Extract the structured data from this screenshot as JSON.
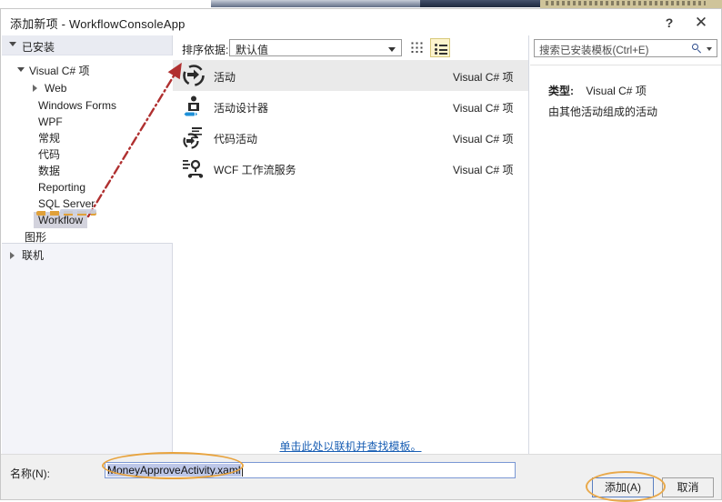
{
  "window": {
    "title": "添加新项 - WorkflowConsoleApp",
    "help_label": "?",
    "close_label": "✕"
  },
  "tree": {
    "header": "已安装",
    "root": "Visual C# 项",
    "items": [
      {
        "label": "Web",
        "expandable": true,
        "indent": 2
      },
      {
        "label": "Windows Forms",
        "expandable": false,
        "indent": 2
      },
      {
        "label": "WPF",
        "expandable": false,
        "indent": 2
      },
      {
        "label": "常规",
        "expandable": false,
        "indent": 2
      },
      {
        "label": "代码",
        "expandable": false,
        "indent": 2
      },
      {
        "label": "数据",
        "expandable": false,
        "indent": 2
      },
      {
        "label": "Reporting",
        "expandable": false,
        "indent": 2
      },
      {
        "label": "SQL Server",
        "expandable": false,
        "indent": 2
      },
      {
        "label": "Workflow",
        "expandable": false,
        "indent": 2,
        "selected": true
      },
      {
        "label": "图形",
        "expandable": false,
        "indent": 1
      }
    ],
    "online": "联机"
  },
  "toolbar": {
    "sort_label": "排序依据:",
    "sort_value": "默认值",
    "grid_view_icon": "grid-view-icon",
    "list_view_icon": "list-view-icon"
  },
  "templates": {
    "rows": [
      {
        "name": "活动",
        "type": "Visual C# 项",
        "icon": "activity-icon",
        "selected": true
      },
      {
        "name": "活动设计器",
        "type": "Visual C# 项",
        "icon": "activity-designer-icon",
        "selected": false
      },
      {
        "name": "代码活动",
        "type": "Visual C# 项",
        "icon": "code-activity-icon",
        "selected": false
      },
      {
        "name": "WCF 工作流服务",
        "type": "Visual C# 项",
        "icon": "wcf-workflow-service-icon",
        "selected": false
      }
    ],
    "online_link": "单击此处以联机并查找模板。"
  },
  "search": {
    "placeholder": "搜索已安装模板(Ctrl+E)",
    "icon": "search-icon"
  },
  "details": {
    "type_label": "类型:",
    "type_value": "Visual C# 项",
    "description": "由其他活动组成的活动"
  },
  "footer": {
    "name_label": "名称(N):",
    "name_value": "MoneyApproveActivity.xaml",
    "add_button": "添加(A)",
    "cancel_button": "取消"
  },
  "annotations": {
    "arrow_color": "#b03030",
    "highlight_color": "#e8a33d"
  }
}
